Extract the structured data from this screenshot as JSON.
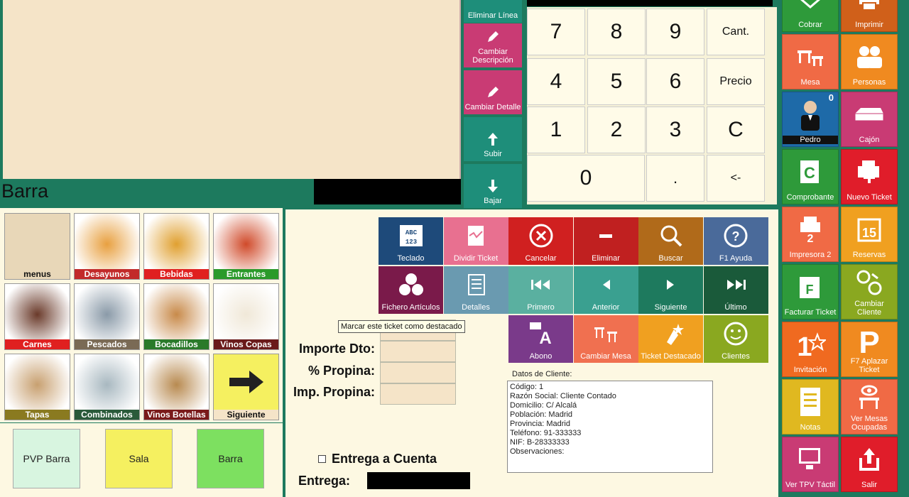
{
  "ticket_area": {
    "title": "Barra"
  },
  "edit_buttons": [
    {
      "label": "Eliminar Línea",
      "color": "#1e8e7a"
    },
    {
      "label": "Cambiar Descripción",
      "color": "#c93b74"
    },
    {
      "label": "Cambiar Detalle",
      "color": "#c93b74"
    },
    {
      "label": "Subir",
      "color": "#1e8e7a"
    },
    {
      "label": "Bajar",
      "color": "#1e8e7a"
    }
  ],
  "keypad": {
    "keys": [
      "7",
      "8",
      "9",
      "Cant.",
      "4",
      "5",
      "6",
      "Precio",
      "1",
      "2",
      "3",
      "C",
      "0",
      ".",
      "<-"
    ]
  },
  "side_buttons": [
    {
      "label": "Cobrar",
      "color": "#2e9a3a",
      "icon": "cash-icon"
    },
    {
      "label": "Imprimir",
      "color": "#d0601a",
      "icon": "printer-icon"
    },
    {
      "label": "Mesa",
      "color": "#f06a45",
      "icon": "table-icon"
    },
    {
      "label": "Personas",
      "color": "#f08a20",
      "icon": "people-icon"
    },
    {
      "label": "Pedro",
      "color": "#1e6aa8",
      "icon": "waiter-icon",
      "badge": "0"
    },
    {
      "label": "Cajón",
      "color": "#c93b74",
      "icon": "drawer-icon"
    },
    {
      "label": "Comprobante",
      "color": "#2e9a3a",
      "icon": "receipt-icon"
    },
    {
      "label": "Nuevo Ticket",
      "color": "#e01d2a",
      "icon": "new-ticket-icon"
    },
    {
      "label": "Impresora 2",
      "color": "#f06a45",
      "icon": "printer-2-icon"
    },
    {
      "label": "Reservas",
      "color": "#f0a020",
      "icon": "calendar-icon"
    },
    {
      "label": "Facturar Ticket",
      "color": "#2e9a3a",
      "icon": "invoice-icon"
    },
    {
      "label": "Cambiar Cliente",
      "color": "#8aa820",
      "icon": "swap-client-icon"
    },
    {
      "label": "Invitación",
      "color": "#f06a20",
      "icon": "invitation-icon"
    },
    {
      "label": "F7 Aplazar Ticket",
      "color": "#f08a20",
      "icon": "parking-icon"
    },
    {
      "label": "Notas",
      "color": "#e0b820",
      "icon": "notes-icon"
    },
    {
      "label": "Ver Mesas Ocupadas",
      "color": "#f06a45",
      "icon": "eye-table-icon"
    },
    {
      "label": "Ver TPV Táctil",
      "color": "#c93b74",
      "icon": "touch-screen-icon"
    },
    {
      "label": "Salir",
      "color": "#e01d2a",
      "icon": "exit-icon"
    }
  ],
  "categories": [
    {
      "label": "menus",
      "color": "#e8d7b8",
      "text": "#111"
    },
    {
      "label": "Desayunos",
      "color": "#c22a2a",
      "text": "#fff"
    },
    {
      "label": "Bebidas",
      "color": "#e02020",
      "text": "#fff"
    },
    {
      "label": "Entrantes",
      "color": "#2a9a2a",
      "text": "#fff"
    },
    {
      "label": "Carnes",
      "color": "#e02020",
      "text": "#fff"
    },
    {
      "label": "Pescados",
      "color": "#7a6a55",
      "text": "#fff"
    },
    {
      "label": "Bocadillos",
      "color": "#2a7a2a",
      "text": "#fff"
    },
    {
      "label": "Vinos Copas",
      "color": "#6a1a1a",
      "text": "#fff"
    },
    {
      "label": "Tapas",
      "color": "#8a7a20",
      "text": "#fff"
    },
    {
      "label": "Combinados",
      "color": "#2a5a3a",
      "text": "#fff"
    },
    {
      "label": "Vinos Botellas",
      "color": "#7a1a1a",
      "text": "#fff"
    },
    {
      "label": "Siguiente",
      "color": "#f5e4c8",
      "text": "#111"
    }
  ],
  "bottom_buttons": [
    {
      "label": "PVP Barra",
      "color": "#d8f5e0"
    },
    {
      "label": "Sala",
      "color": "#f5f060"
    },
    {
      "label": "Barra",
      "color": "#7de060"
    }
  ],
  "tiles": [
    {
      "label": "Teclado",
      "color": "#1e4a7a",
      "icon": "keyboard-icon"
    },
    {
      "label": "Dividir Ticket",
      "color": "#e87090",
      "icon": "split-ticket-icon"
    },
    {
      "label": "Cancelar",
      "color": "#d02020",
      "icon": "cancel-icon"
    },
    {
      "label": "Eliminar",
      "color": "#c02020",
      "icon": "delete-icon"
    },
    {
      "label": "Buscar",
      "color": "#b06a1a",
      "icon": "search-icon"
    },
    {
      "label": "F1 Ayuda",
      "color": "#4a6a9a",
      "icon": "help-icon"
    },
    {
      "label": "Fichero Artículos",
      "color": "#7a1a4a",
      "icon": "articles-icon"
    },
    {
      "label": "Detalles",
      "color": "#6a9ab0",
      "icon": "details-icon"
    },
    {
      "label": "Primero",
      "color": "#5ab0a0",
      "icon": "first-icon"
    },
    {
      "label": "Anterior",
      "color": "#3aa090",
      "icon": "previous-icon"
    },
    {
      "label": "Siguiente",
      "color": "#1e7a5e",
      "icon": "next-icon"
    },
    {
      "label": "Último",
      "color": "#1a5a3a",
      "icon": "last-icon"
    },
    {
      "label": "Abono",
      "color": "#7a3a8a",
      "icon": "refund-icon"
    },
    {
      "label": "Cambiar Mesa",
      "color": "#f07050",
      "icon": "change-table-icon"
    },
    {
      "label": "Ticket Destacado",
      "color": "#f0a020",
      "icon": "star-ticket-icon"
    },
    {
      "label": "Clientes",
      "color": "#8aa820",
      "icon": "smiley-icon"
    }
  ],
  "fields": {
    "importe_dto": "Importe Dto:",
    "propina_pct": "% Propina:",
    "imp_propina": "Imp. Propina:",
    "entrega_cuenta": "Entrega a Cuenta",
    "entrega": "Entrega:"
  },
  "tooltip": "Marcar este ticket como destacado",
  "client": {
    "title": "Datos de Cliente:",
    "lines": [
      "Código: 1",
      "Razón Social: Cliente Contado",
      "Domicilio: C/ Alcalá",
      "Población: Madrid",
      "Provincia: Madrid",
      "Teléfono: 91-333333",
      "NIF: B-28333333",
      "Observaciones:"
    ]
  }
}
